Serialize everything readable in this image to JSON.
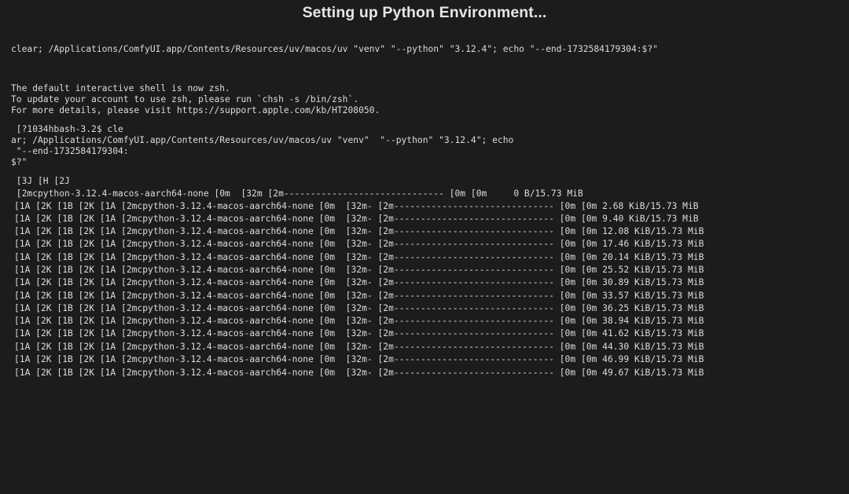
{
  "window": {
    "title": "Setting up Python Environment..."
  },
  "terminal": {
    "command_line": "clear; /Applications/ComfyUI.app/Contents/Resources/uv/macos/uv \"venv\" \"--python\" \"3.12.4\"; echo \"--end-1732584179304:$?\"",
    "notice": [
      "The default interactive shell is now zsh.",
      "To update your account to use zsh, please run `chsh -s /bin/zsh`.",
      "For more details, please visit https://support.apple.com/kb/HT208050."
    ],
    "prompt_lines": [
      " [?1034hbash-3.2$ cle",
      "ar; /Applications/ComfyUI.app/Contents/Resources/uv/macos/uv \"venv\"  \"--python\" \"3.12.4\"; echo",
      " \"--end-1732584179304:",
      "$?\""
    ],
    "clear_seq": " [3J [H [2J",
    "first_progress": " [2mcpython-3.12.4-macos-aarch64-none [0m  [32m [2m------------------------------ [0m [0m     0 B/15.73 MiB",
    "progress_lines": [
      "[1A [2K [1B [2K [1A [2mcpython-3.12.4-macos-aarch64-none [0m  [32m- [2m------------------------------ [0m [0m 2.68 KiB/15.73 MiB",
      "[1A [2K [1B [2K [1A [2mcpython-3.12.4-macos-aarch64-none [0m  [32m- [2m------------------------------ [0m [0m 9.40 KiB/15.73 MiB",
      "[1A [2K [1B [2K [1A [2mcpython-3.12.4-macos-aarch64-none [0m  [32m- [2m------------------------------ [0m [0m 12.08 KiB/15.73 MiB",
      "[1A [2K [1B [2K [1A [2mcpython-3.12.4-macos-aarch64-none [0m  [32m- [2m------------------------------ [0m [0m 17.46 KiB/15.73 MiB",
      "[1A [2K [1B [2K [1A [2mcpython-3.12.4-macos-aarch64-none [0m  [32m- [2m------------------------------ [0m [0m 20.14 KiB/15.73 MiB",
      "[1A [2K [1B [2K [1A [2mcpython-3.12.4-macos-aarch64-none [0m  [32m- [2m------------------------------ [0m [0m 25.52 KiB/15.73 MiB",
      "[1A [2K [1B [2K [1A [2mcpython-3.12.4-macos-aarch64-none [0m  [32m- [2m------------------------------ [0m [0m 30.89 KiB/15.73 MiB",
      "[1A [2K [1B [2K [1A [2mcpython-3.12.4-macos-aarch64-none [0m  [32m- [2m------------------------------ [0m [0m 33.57 KiB/15.73 MiB",
      "[1A [2K [1B [2K [1A [2mcpython-3.12.4-macos-aarch64-none [0m  [32m- [2m------------------------------ [0m [0m 36.25 KiB/15.73 MiB",
      "[1A [2K [1B [2K [1A [2mcpython-3.12.4-macos-aarch64-none [0m  [32m- [2m------------------------------ [0m [0m 38.94 KiB/15.73 MiB",
      "[1A [2K [1B [2K [1A [2mcpython-3.12.4-macos-aarch64-none [0m  [32m- [2m------------------------------ [0m [0m 41.62 KiB/15.73 MiB",
      "[1A [2K [1B [2K [1A [2mcpython-3.12.4-macos-aarch64-none [0m  [32m- [2m------------------------------ [0m [0m 44.30 KiB/15.73 MiB",
      "[1A [2K [1B [2K [1A [2mcpython-3.12.4-macos-aarch64-none [0m  [32m- [2m------------------------------ [0m [0m 46.99 KiB/15.73 MiB",
      "[1A [2K [1B [2K [1A [2mcpython-3.12.4-macos-aarch64-none [0m  [32m- [2m------------------------------ [0m [0m 49.67 KiB/15.73 MiB"
    ]
  }
}
